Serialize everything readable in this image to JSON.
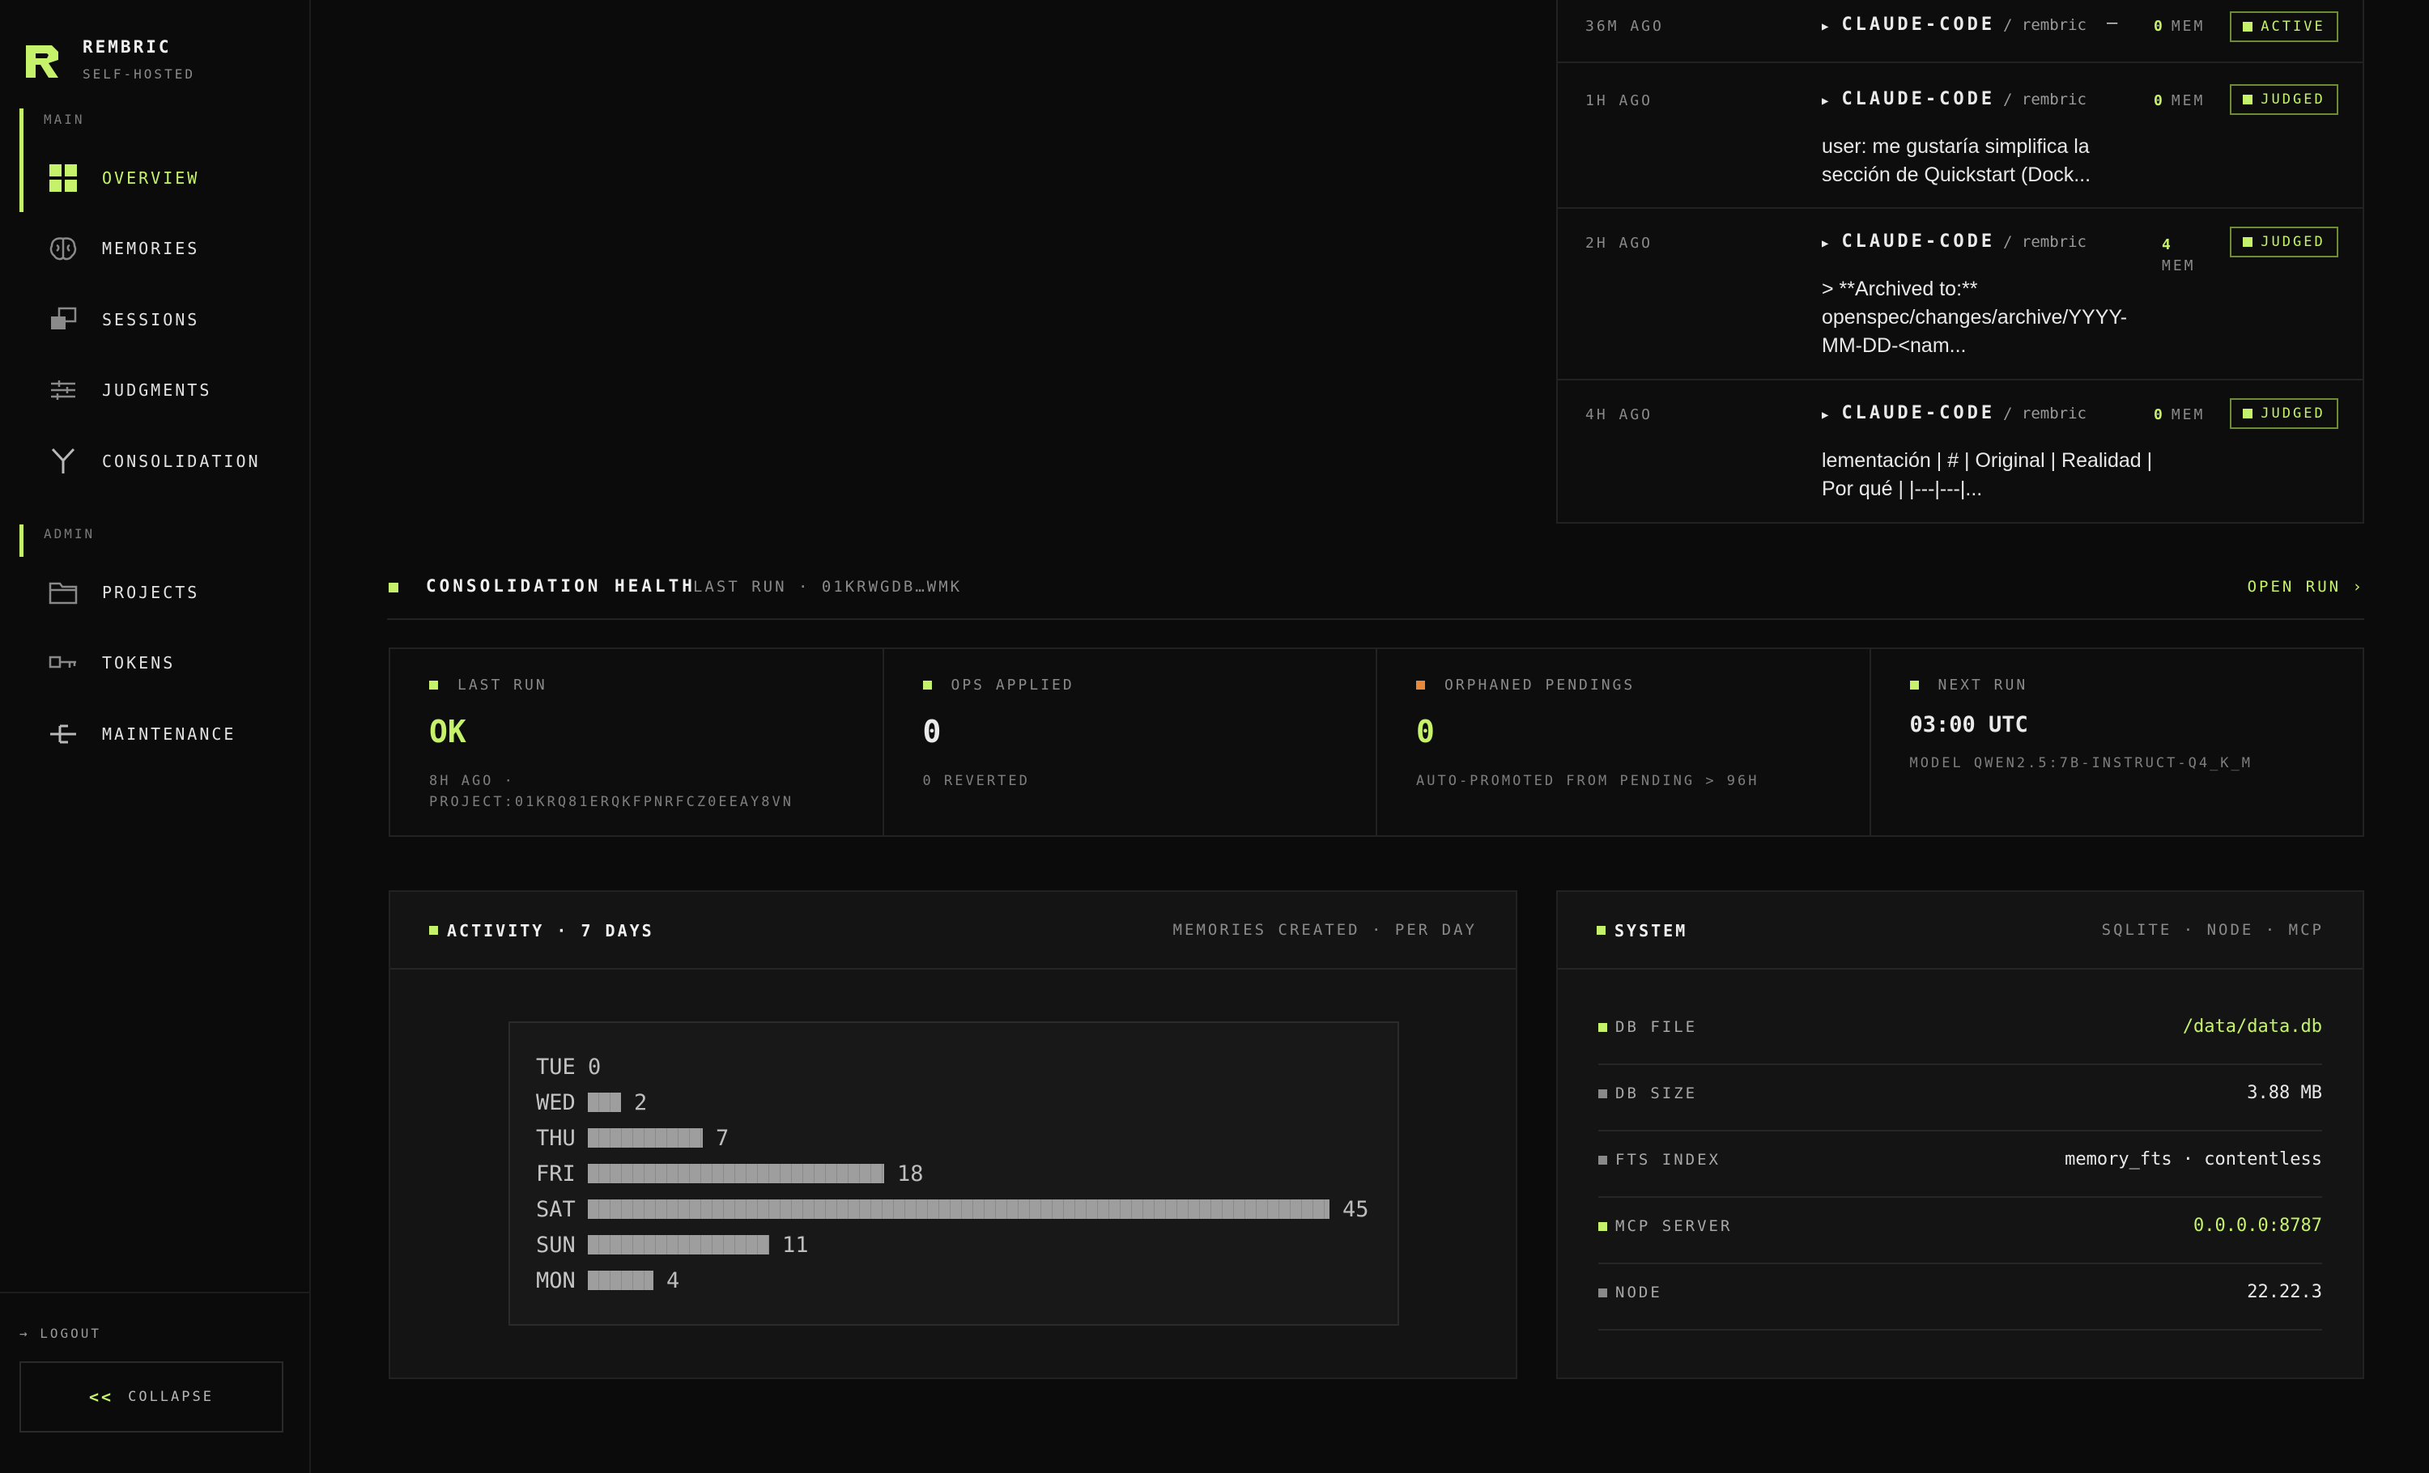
{
  "brand": {
    "name": "REMBRIC",
    "subtitle": "SELF-HOSTED"
  },
  "sidebar": {
    "main_label": "MAIN",
    "admin_label": "ADMIN",
    "main_items": [
      {
        "label": "OVERVIEW",
        "icon": "grid-icon",
        "active": true
      },
      {
        "label": "MEMORIES",
        "icon": "brain-icon",
        "active": false
      },
      {
        "label": "SESSIONS",
        "icon": "windows-icon",
        "active": false
      },
      {
        "label": "JUDGMENTS",
        "icon": "sliders-icon",
        "active": false
      },
      {
        "label": "CONSOLIDATION",
        "icon": "merge-icon",
        "active": false
      }
    ],
    "admin_items": [
      {
        "label": "PROJECTS",
        "icon": "folder-icon"
      },
      {
        "label": "TOKENS",
        "icon": "key-icon"
      },
      {
        "label": "MAINTENANCE",
        "icon": "wrench-icon"
      }
    ],
    "logout": "→ LOGOUT",
    "collapse_chevron": "<<",
    "collapse": "COLLAPSE"
  },
  "sessions": [
    {
      "time": "36M AGO",
      "agent": "CLAUDE-CODE",
      "project": "/ rembric",
      "dash": "—",
      "mem_count": "0",
      "mem_unit": "MEM",
      "status": "ACTIVE",
      "text": ""
    },
    {
      "time": "1H AGO",
      "agent": "CLAUDE-CODE",
      "project": "/ rembric",
      "dash": "",
      "mem_count": "0",
      "mem_unit": "MEM",
      "status": "JUDGED",
      "text": "user: me gustaría simplifica la sección de Quickstart (Dock..."
    },
    {
      "time": "2H AGO",
      "agent": "CLAUDE-CODE",
      "project": "/ rembric",
      "dash": "",
      "mem_count": "4",
      "mem_unit": "MEM",
      "status": "JUDGED",
      "text": "> **Archived to:** openspec/changes/archive/YYYY-MM-DD-<nam..."
    },
    {
      "time": "4H AGO",
      "agent": "CLAUDE-CODE",
      "project": "/ rembric",
      "dash": "",
      "mem_count": "0",
      "mem_unit": "MEM",
      "status": "JUDGED",
      "text": "lementación | # | Original | Realidad | Por qué | |---|---|..."
    }
  ],
  "consolidation": {
    "title": "CONSOLIDATION HEALTH",
    "meta": "LAST RUN · 01KRWGDB…WMK",
    "open_run": "OPEN RUN ›",
    "cells": [
      {
        "label": "LAST RUN",
        "value": "OK",
        "sub": "8H AGO · PROJECT:01KRQ81ERQKFPNRFCZ0EEAY8VN",
        "dot_color": "#c6f26b",
        "value_color": "#c6f26b"
      },
      {
        "label": "OPS APPLIED",
        "value": "0",
        "sub": "0 REVERTED",
        "dot_color": "#c6f26b",
        "value_color": "#eaeaea"
      },
      {
        "label": "ORPHANED PENDINGS",
        "value": "0",
        "sub": "AUTO-PROMOTED FROM PENDING > 96H",
        "dot_color": "#e8893a",
        "value_color": "#c6f26b"
      },
      {
        "label": "NEXT RUN",
        "value": "03:00 UTC",
        "sub": "MODEL QWEN2.5:7B-INSTRUCT-Q4_K_M",
        "dot_color": "#c6f26b",
        "value_color": "#eaeaea"
      }
    ]
  },
  "activity": {
    "title": "ACTIVITY · 7 DAYS",
    "meta": "MEMORIES CREATED · PER DAY",
    "chart_data": {
      "type": "bar",
      "categories": [
        "TUE",
        "WED",
        "THU",
        "FRI",
        "SAT",
        "SUN",
        "MON"
      ],
      "values": [
        0,
        2,
        7,
        18,
        45,
        11,
        4
      ]
    }
  },
  "system": {
    "title": "SYSTEM",
    "meta": "SQLITE · NODE · MCP",
    "rows": [
      {
        "label": "DB FILE",
        "value": "/data/data.db",
        "highlight": true
      },
      {
        "label": "DB SIZE",
        "value": "3.88 MB",
        "highlight": false
      },
      {
        "label": "FTS INDEX",
        "value": "memory_fts · contentless",
        "highlight": false
      },
      {
        "label": "MCP SERVER",
        "value": "0.0.0.0:8787",
        "highlight": true
      },
      {
        "label": "NODE",
        "value": "22.22.3",
        "highlight": false
      }
    ]
  },
  "colors": {
    "accent": "#c6f26b",
    "warn": "#e8893a",
    "bg": "#0b0b0b"
  }
}
